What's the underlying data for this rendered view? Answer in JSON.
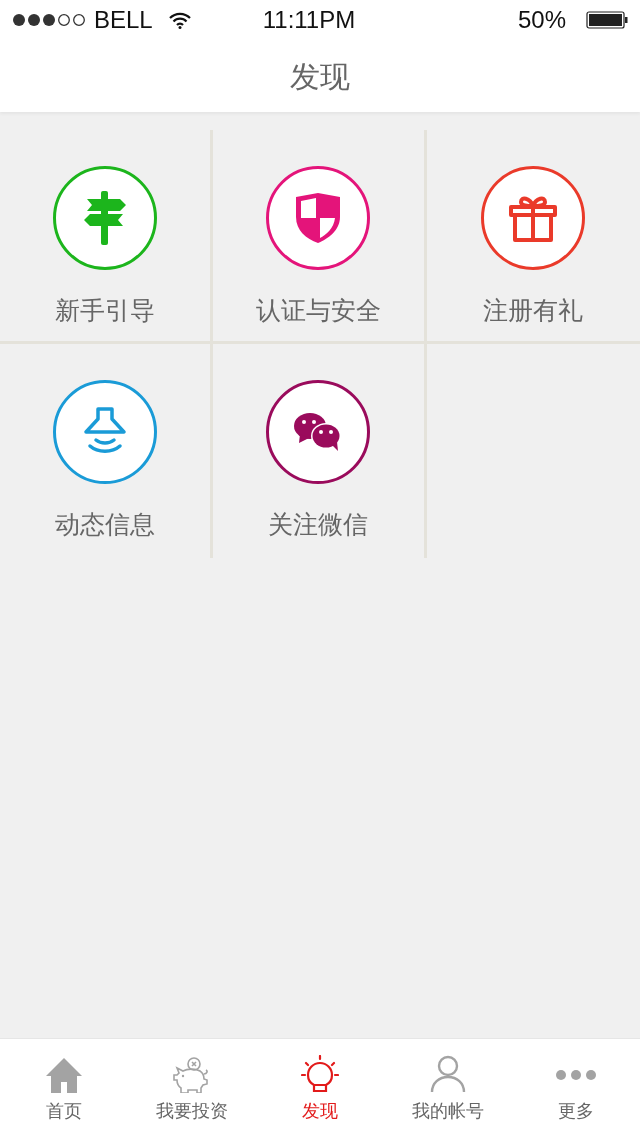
{
  "status_bar": {
    "carrier": "BELL",
    "time": "11:11PM",
    "battery": "50%"
  },
  "header": {
    "title": "发现"
  },
  "tiles": [
    {
      "label": "新手引导",
      "kind": "signpost",
      "color": "#1cb51c"
    },
    {
      "label": "认证与安全",
      "kind": "shield",
      "color": "#e4147a"
    },
    {
      "label": "注册有礼",
      "kind": "gift",
      "color": "#ea3a2a"
    },
    {
      "label": "动态信息",
      "kind": "bell",
      "color": "#1a9bd7"
    },
    {
      "label": "关注微信",
      "kind": "chat",
      "color": "#9a0b5c"
    }
  ],
  "tab_bar": [
    {
      "label": "首页",
      "kind": "home",
      "selected": false
    },
    {
      "label": "我要投资",
      "kind": "piggy",
      "selected": false
    },
    {
      "label": "发现",
      "kind": "bulb",
      "selected": true
    },
    {
      "label": "我的帐号",
      "kind": "person",
      "selected": false
    },
    {
      "label": "更多",
      "kind": "more",
      "selected": false
    }
  ]
}
